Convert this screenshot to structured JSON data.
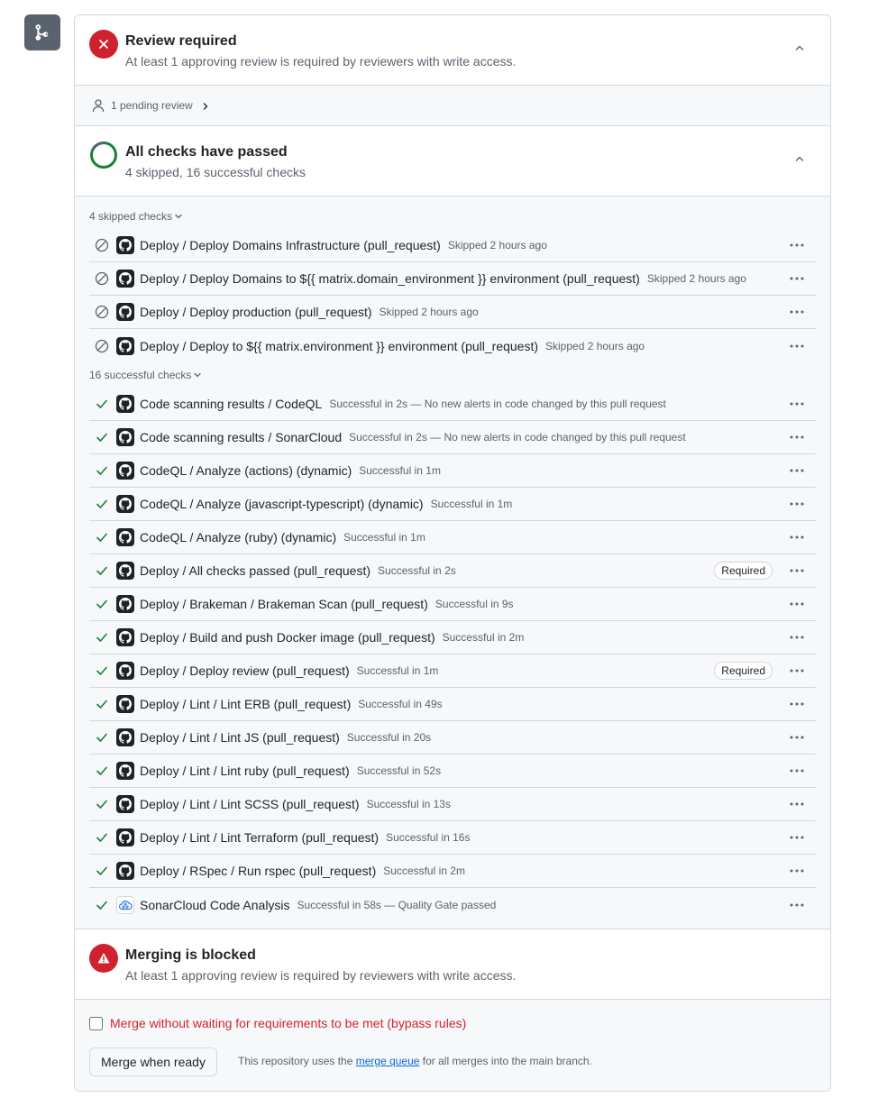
{
  "review": {
    "title": "Review required",
    "subtitle": "At least 1 approving review is required by reviewers with write access.",
    "pending": "1 pending review"
  },
  "checks": {
    "title": "All checks have passed",
    "subtitle": "4 skipped, 16 successful checks",
    "skipped_toggle": "4 skipped checks",
    "successful_toggle": "16 successful checks",
    "skipped": [
      {
        "name": "Deploy / Deploy Domains Infrastructure (pull_request)",
        "meta": "Skipped 2 hours ago"
      },
      {
        "name": "Deploy / Deploy Domains to ${{ matrix.domain_environment }} environment (pull_request)",
        "meta": "Skipped 2 hours ago"
      },
      {
        "name": "Deploy / Deploy production (pull_request)",
        "meta": "Skipped 2 hours ago"
      },
      {
        "name": "Deploy / Deploy to ${{ matrix.environment }} environment (pull_request)",
        "meta": "Skipped 2 hours ago"
      }
    ],
    "successful": [
      {
        "name": "Code scanning results / CodeQL",
        "meta": "Successful in 2s — No new alerts in code changed by this pull request",
        "app": "github-icon"
      },
      {
        "name": "Code scanning results / SonarCloud",
        "meta": "Successful in 2s — No new alerts in code changed by this pull request",
        "app": "github-icon"
      },
      {
        "name": "CodeQL / Analyze (actions) (dynamic)",
        "meta": "Successful in 1m",
        "app": "github-icon"
      },
      {
        "name": "CodeQL / Analyze (javascript-typescript) (dynamic)",
        "meta": "Successful in 1m",
        "app": "github-icon"
      },
      {
        "name": "CodeQL / Analyze (ruby) (dynamic)",
        "meta": "Successful in 1m",
        "app": "github-icon"
      },
      {
        "name": "Deploy / All checks passed (pull_request)",
        "meta": "Successful in 2s",
        "app": "github-icon",
        "required": "Required"
      },
      {
        "name": "Deploy / Brakeman / Brakeman Scan (pull_request)",
        "meta": "Successful in 9s",
        "app": "github-icon"
      },
      {
        "name": "Deploy / Build and push Docker image (pull_request)",
        "meta": "Successful in 2m",
        "app": "github-icon"
      },
      {
        "name": "Deploy / Deploy review (pull_request)",
        "meta": "Successful in 1m",
        "app": "github-icon",
        "required": "Required"
      },
      {
        "name": "Deploy / Lint / Lint ERB (pull_request)",
        "meta": "Successful in 49s",
        "app": "github-icon"
      },
      {
        "name": "Deploy / Lint / Lint JS (pull_request)",
        "meta": "Successful in 20s",
        "app": "github-icon"
      },
      {
        "name": "Deploy / Lint / Lint ruby (pull_request)",
        "meta": "Successful in 52s",
        "app": "github-icon"
      },
      {
        "name": "Deploy / Lint / Lint SCSS (pull_request)",
        "meta": "Successful in 13s",
        "app": "github-icon"
      },
      {
        "name": "Deploy / Lint / Lint Terraform (pull_request)",
        "meta": "Successful in 16s",
        "app": "github-icon"
      },
      {
        "name": "Deploy / RSpec / Run rspec (pull_request)",
        "meta": "Successful in 2m",
        "app": "github-icon"
      },
      {
        "name": "SonarCloud Code Analysis",
        "meta": "Successful in 58s — Quality Gate passed",
        "app": "sonarcloud-icon"
      }
    ]
  },
  "blocked": {
    "title": "Merging is blocked",
    "subtitle": "At least 1 approving review is required by reviewers with write access."
  },
  "merge": {
    "bypass_label": "Merge without waiting for requirements to be met (bypass rules)",
    "button_label": "Merge when ready",
    "note_prefix": "This repository uses the",
    "note_link": "merge queue",
    "note_suffix": "for all merges into the main branch."
  },
  "colors": {
    "danger": "#cf222e",
    "success": "#1a7f37",
    "muted": "#59636e",
    "link": "#0969da"
  }
}
